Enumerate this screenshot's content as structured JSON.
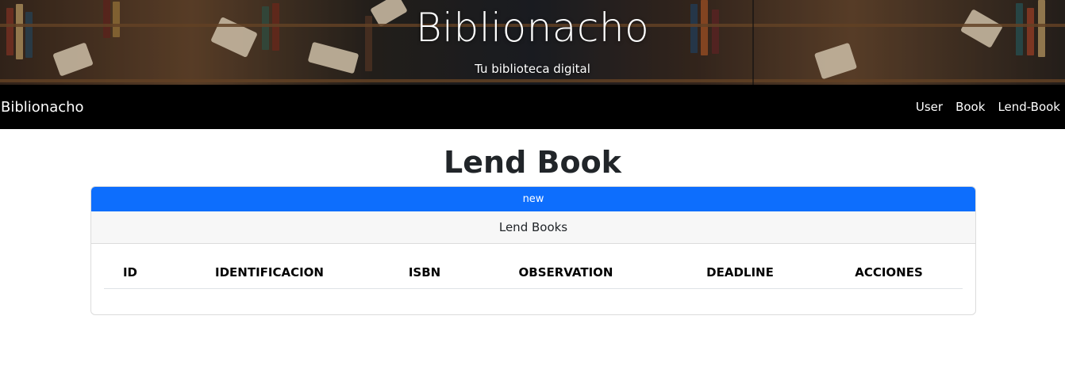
{
  "hero": {
    "title": "Biblionacho",
    "subtitle": "Tu biblioteca digital"
  },
  "navbar": {
    "brand": "Biblionacho",
    "links": [
      {
        "label": "User"
      },
      {
        "label": "Book"
      },
      {
        "label": "Lend-Book"
      }
    ]
  },
  "main": {
    "title": "Lend Book",
    "new_button": "new",
    "card_header": "Lend Books",
    "table": {
      "columns": [
        "ID",
        "IDENTIFICACION",
        "ISBN",
        "OBSERVATION",
        "DEADLINE",
        "ACCIONES"
      ],
      "rows": []
    }
  },
  "colors": {
    "navbar_bg": "#000000",
    "primary": "#0d6efd",
    "card_header_bg": "#f7f7f7"
  }
}
